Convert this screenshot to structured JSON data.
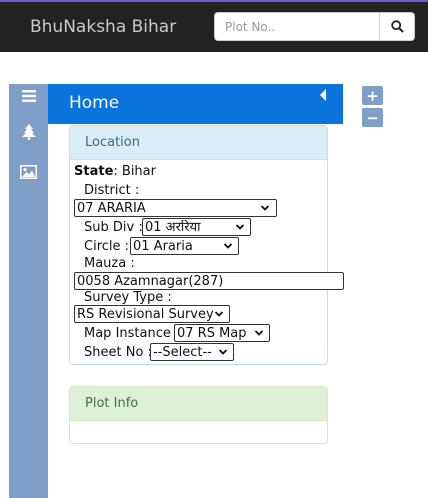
{
  "navbar": {
    "brand": "BhuNaksha Bihar",
    "search_placeholder": "Plot No..",
    "search_icon": "search-icon"
  },
  "sidebar": {
    "tabs": [
      {
        "icon": "menu-icon"
      },
      {
        "icon": "tree-icon"
      },
      {
        "icon": "image-icon"
      }
    ]
  },
  "header": {
    "title": "Home",
    "collapse_icon": "caret-left-icon"
  },
  "zoom": {
    "in_label": "+",
    "out_label": "−"
  },
  "location_panel": {
    "heading": "Location",
    "state_label": "State",
    "state_value": ": Bihar",
    "district_label": "District :",
    "district_value": "07 ARARIA",
    "subdiv_label": "Sub Div :",
    "subdiv_value": "01 अररिया",
    "circle_label": "Circle :",
    "circle_value": "01 Araria",
    "mauza_label": "Mauza :",
    "mauza_value": "0058 Azamnagar(287)",
    "survey_type_label": "Survey Type :",
    "survey_type_value": "RS Revisional Survey",
    "map_instance_label": "Map Instance :",
    "map_instance_value": "07 RS Map",
    "sheet_label": "Sheet No :",
    "sheet_value": "--Select--"
  },
  "plot_panel": {
    "heading": "Plot Info"
  },
  "colors": {
    "navbar_bg": "#222222",
    "header_blue": "#0a74da",
    "sidebar_blue": "#7f9fc8",
    "info_heading_bg": "#d9edf7",
    "success_heading_bg": "#dff0d8"
  }
}
